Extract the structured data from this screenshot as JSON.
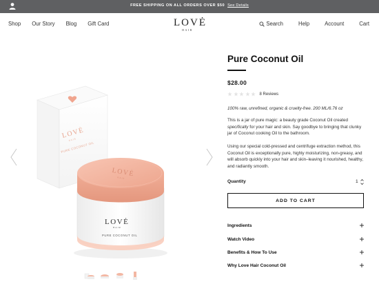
{
  "promo": {
    "text": "FREE SHIPPING ON ALL ORDERS OVER $50",
    "link": "See Details"
  },
  "nav": {
    "left": [
      "Shop",
      "Our Story",
      "Blog",
      "Gift Card"
    ],
    "search": "Search",
    "help": "Help",
    "account": "Account",
    "cart": "Cart"
  },
  "logo": {
    "main": "LOVĖ",
    "sub": "HAIR"
  },
  "product": {
    "title": "Pure Coconut Oil",
    "price": "$28.00",
    "rating": 0,
    "reviews": "8 Reviews",
    "tagline": "100% raw, unrefined, organic & cruelty-free. 200 ML/6.76 oz",
    "desc1_a": "This is a jar of pure magic: a beauty grade Coconut Oil created ",
    "desc1_em": "specifically",
    "desc1_b": " for your hair and skin. Say goodbye to bringing that clunky jar of Coconut cooking Oil to the bathroom.",
    "desc2": "Using our special cold-pressed and centrifuge extraction method, this Coconut Oil is exceptionally pure, highly moisturizing, non-greasy, and will absorb quickly into your hair and skin–leaving it nourished, healthy, and radiantly smooth.",
    "quantity_label": "Quantity",
    "quantity": "1",
    "add_to_cart": "ADD TO CART",
    "packaging": {
      "box_brand": "LOVĖ",
      "box_brand_sub": "HAIR",
      "box_product": "PURE COCONUT OIL",
      "jar_lid": "LOVĖ",
      "jar_lid_sub": "HAIR",
      "jar_brand": "LOVĖ",
      "jar_brand_sub": "HAIR",
      "jar_product": "PURE COCONUT OIL"
    }
  },
  "accordion": [
    "Ingredients",
    "Watch Video",
    "Benefits & How To Use",
    "Why Love Hair Coconut Oil"
  ],
  "colors": {
    "promo_bg": "#5f6062",
    "peach": "#f3b7a3",
    "peach_dark": "#e9a089",
    "star_empty": "#e4e4e4"
  },
  "icons": {
    "user": "user-icon",
    "search": "search-icon",
    "arrow_left": "chevron-left-icon",
    "arrow_right": "chevron-right-icon",
    "plus": "plus-icon",
    "stepper": "quantity-stepper-icon"
  }
}
